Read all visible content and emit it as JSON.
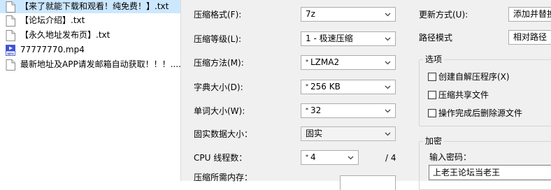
{
  "files": [
    {
      "name": "【来了就能下载和观看！纯免费！】.txt",
      "icon": "text-file-icon",
      "selected": true
    },
    {
      "name": "【论坛介绍】.txt",
      "icon": "text-file-icon",
      "selected": false
    },
    {
      "name": "【永久地址发布页】.txt",
      "icon": "text-file-icon",
      "selected": false
    },
    {
      "name": "77777770.mp4",
      "icon": "mp4-file-icon",
      "selected": false
    },
    {
      "name": "最新地址及APP请发邮箱自动获取！！！....",
      "icon": "text-file-icon",
      "selected": false
    }
  ],
  "dialog": {
    "format_label": "压缩格式(F):",
    "format_value": "7z",
    "level_label": "压缩等级(L):",
    "level_value": "1 - 极速压缩",
    "method_label": "压缩方法(M):",
    "method_value": "LZMA2",
    "dict_label": "字典大小(D):",
    "dict_value": "256 KB",
    "word_label": "单词大小(W):",
    "word_value": "32",
    "solid_label": "固实数据大小：",
    "solid_value": "固实",
    "cpu_label": "CPU 线程数：",
    "cpu_value": "4",
    "cpu_max": "/ 4",
    "memory_label": "压缩所需内存：",
    "update_label": "更新方式(U):",
    "update_value": "添加并替换",
    "path_label": "路径模式",
    "path_value": "相对路径",
    "options_title": "选项",
    "opt_sfx": "创建自解压程序(X)",
    "opt_shared": "压缩共享文件",
    "opt_delete": "操作完成后删除源文件",
    "encrypt_title": "加密",
    "password_label": "输入密码：",
    "password_value": "上老王论坛当老王"
  }
}
